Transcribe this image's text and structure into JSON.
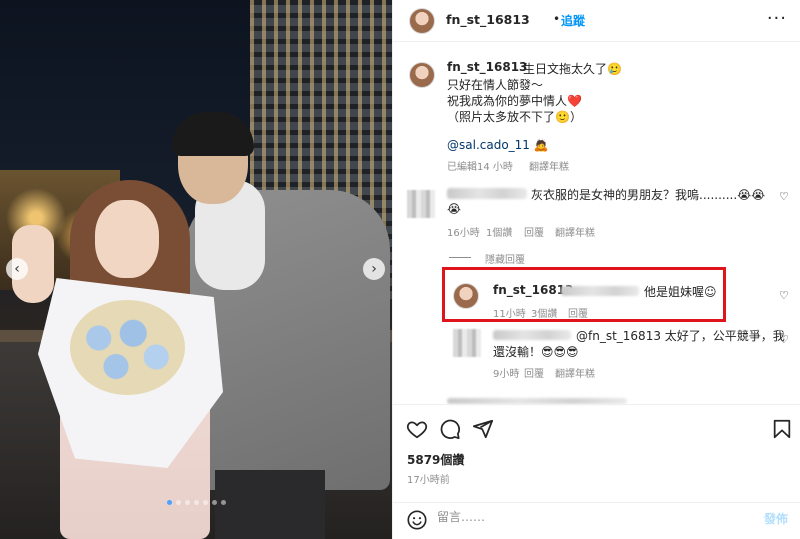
{
  "post": {
    "username": "fn_st_16813",
    "follow_separator": "•",
    "follow_label": "追蹤",
    "more_label": "···",
    "photo_dots": 7,
    "photo_active_dot": 0
  },
  "caption": {
    "username": "fn_st_16813",
    "line1": "生日文拖太久了🥲",
    "line2": "只好在情人節發～",
    "line3": "祝我成為你的夢中情人❤️",
    "line4": "（照片太多放不下了🙂）",
    "mention": "@sal.cado_11 🙇",
    "meta_edited": "已編輯",
    "meta_time": "14 小時",
    "meta_translate": "翻譯年糕"
  },
  "comments": [
    {
      "text": "灰衣服的是女神的男朋友？我嗚..........😭😭",
      "text2": "😭",
      "time": "16小時",
      "likes": "1個讚",
      "reply": "回覆",
      "translate": "翻譯年糕"
    }
  ],
  "hide_replies_label": "隱藏回覆",
  "reply_highlighted": {
    "username": "fn_st_16813",
    "text": "他是姐妹喔☺",
    "time": "11小時",
    "likes": "3個讚",
    "reply": "回覆"
  },
  "reply_second": {
    "text_line1": "@fn_st_16813 太好了，公平競爭，我",
    "text_line2": "還沒輸！😎😎😎",
    "time": "9小時",
    "reply": "回覆",
    "translate": "翻譯年糕"
  },
  "footer": {
    "likes": "5879個讚",
    "time_ago": "17小時前",
    "comment_placeholder": "留言……",
    "post_label": "發佈"
  },
  "icons": {
    "like": "heart-icon",
    "comment": "comment-icon",
    "share": "send-icon",
    "save": "bookmark-icon",
    "emoji": "smile-icon"
  },
  "colors": {
    "accent": "#0095f6",
    "highlight_border": "#e0141c",
    "muted": "#8e8e8e"
  }
}
